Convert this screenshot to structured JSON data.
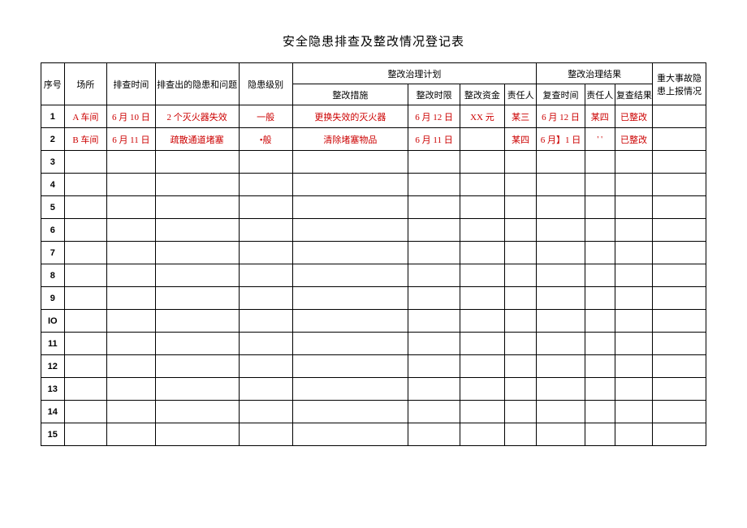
{
  "title": "安全隐患排查及整改情况登记表",
  "headers": {
    "seq": "序号",
    "location": "场所",
    "inspect_time": "排查时间",
    "issue": "排查出的隐患和问题",
    "level": "隐患级别",
    "plan_group": "整改治理计划",
    "measure": "整改措施",
    "deadline": "整改时限",
    "funds": "整改资金",
    "resp1": "责任人",
    "result_group": "整改治理结果",
    "recheck_time": "复查时间",
    "resp2": "责任人",
    "recheck_res": "复查结果",
    "report": "重大事故隐患上报情况"
  },
  "rows": [
    {
      "seq": "1",
      "location": "A 车间",
      "inspect_time": "6 月 10 日",
      "issue": "2 个灭火器失效",
      "level": "一般",
      "measure": "更换失效的灭火器",
      "deadline": "6 月 12 日",
      "funds": "XX 元",
      "resp1": "某三",
      "recheck_time": "6 月 12 日",
      "resp2": "某四",
      "recheck_res": "已整改",
      "report": ""
    },
    {
      "seq": "2",
      "location": "B 车间",
      "inspect_time": "6 月 11 日",
      "issue": "疏散通道堵塞",
      "level": "•般",
      "measure": "清除堵塞物品",
      "deadline": "6 月 11 日",
      "funds": "",
      "resp1": "某四",
      "recheck_time": "6 月】1 日",
      "resp2": "' '",
      "recheck_res": "已整改",
      "report": ""
    },
    {
      "seq": "3",
      "location": "",
      "inspect_time": "",
      "issue": "",
      "level": "",
      "measure": "",
      "deadline": "",
      "funds": "",
      "resp1": "",
      "recheck_time": "",
      "resp2": "",
      "recheck_res": "",
      "report": ""
    },
    {
      "seq": "4",
      "location": "",
      "inspect_time": "",
      "issue": "",
      "level": "",
      "measure": "",
      "deadline": "",
      "funds": "",
      "resp1": "",
      "recheck_time": "",
      "resp2": "",
      "recheck_res": "",
      "report": ""
    },
    {
      "seq": "5",
      "location": "",
      "inspect_time": "",
      "issue": "",
      "level": "",
      "measure": "",
      "deadline": "",
      "funds": "",
      "resp1": "",
      "recheck_time": "",
      "resp2": "",
      "recheck_res": "",
      "report": ""
    },
    {
      "seq": "6",
      "location": "",
      "inspect_time": "",
      "issue": "",
      "level": "",
      "measure": "",
      "deadline": "",
      "funds": "",
      "resp1": "",
      "recheck_time": "",
      "resp2": "",
      "recheck_res": "",
      "report": ""
    },
    {
      "seq": "7",
      "location": "",
      "inspect_time": "",
      "issue": "",
      "level": "",
      "measure": "",
      "deadline": "",
      "funds": "",
      "resp1": "",
      "recheck_time": "",
      "resp2": "",
      "recheck_res": "",
      "report": ""
    },
    {
      "seq": "8",
      "location": "",
      "inspect_time": "",
      "issue": "",
      "level": "",
      "measure": "",
      "deadline": "",
      "funds": "",
      "resp1": "",
      "recheck_time": "",
      "resp2": "",
      "recheck_res": "",
      "report": ""
    },
    {
      "seq": "9",
      "location": "",
      "inspect_time": "",
      "issue": "",
      "level": "",
      "measure": "",
      "deadline": "",
      "funds": "",
      "resp1": "",
      "recheck_time": "",
      "resp2": "",
      "recheck_res": "",
      "report": ""
    },
    {
      "seq": "IO",
      "location": "",
      "inspect_time": "",
      "issue": "",
      "level": "",
      "measure": "",
      "deadline": "",
      "funds": "",
      "resp1": "",
      "recheck_time": "",
      "resp2": "",
      "recheck_res": "",
      "report": ""
    },
    {
      "seq": "11",
      "location": "",
      "inspect_time": "",
      "issue": "",
      "level": "",
      "measure": "",
      "deadline": "",
      "funds": "",
      "resp1": "",
      "recheck_time": "",
      "resp2": "",
      "recheck_res": "",
      "report": ""
    },
    {
      "seq": "12",
      "location": "",
      "inspect_time": "",
      "issue": "",
      "level": "",
      "measure": "",
      "deadline": "",
      "funds": "",
      "resp1": "",
      "recheck_time": "",
      "resp2": "",
      "recheck_res": "",
      "report": ""
    },
    {
      "seq": "13",
      "location": "",
      "inspect_time": "",
      "issue": "",
      "level": "",
      "measure": "",
      "deadline": "",
      "funds": "",
      "resp1": "",
      "recheck_time": "",
      "resp2": "",
      "recheck_res": "",
      "report": ""
    },
    {
      "seq": "14",
      "location": "",
      "inspect_time": "",
      "issue": "",
      "level": "",
      "measure": "",
      "deadline": "",
      "funds": "",
      "resp1": "",
      "recheck_time": "",
      "resp2": "",
      "recheck_res": "",
      "report": ""
    },
    {
      "seq": "15",
      "location": "",
      "inspect_time": "",
      "issue": "",
      "level": "",
      "measure": "",
      "deadline": "",
      "funds": "",
      "resp1": "",
      "recheck_time": "",
      "resp2": "",
      "recheck_res": "",
      "report": ""
    }
  ]
}
